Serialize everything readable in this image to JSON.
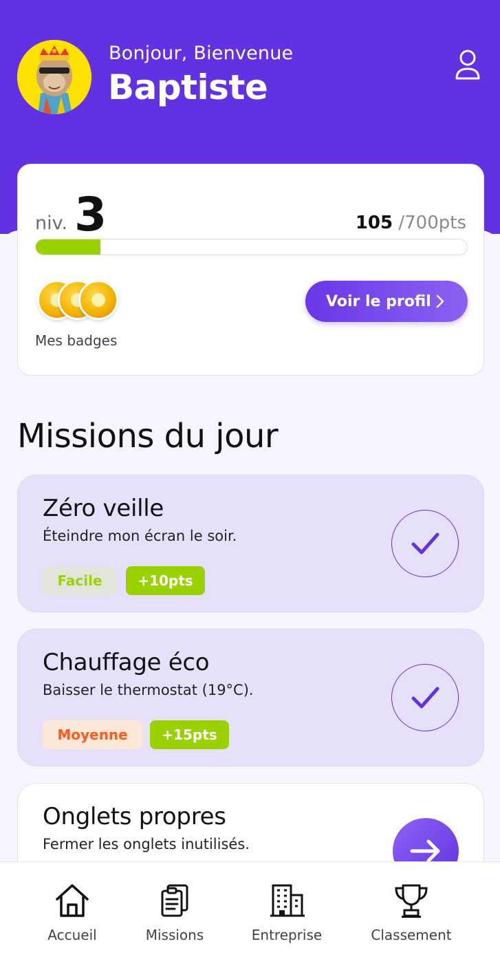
{
  "header": {
    "greeting": "Bonjour, Bienvenue",
    "username": "Baptiste",
    "avatar_icon": "ape-avatar-icon",
    "profile_icon": "user-icon"
  },
  "level_card": {
    "level_prefix": "niv.",
    "level_value": "3",
    "points_current": "105",
    "points_total": "/700pts",
    "progress_fraction": 0.15,
    "badges_label": "Mes badges",
    "badges_count": 3,
    "profile_button_label": "Voir le profil"
  },
  "missions": {
    "title": "Missions du jour",
    "items": [
      {
        "title": "Zéro veille",
        "description": "Éteindre mon écran le soir.",
        "difficulty": "Facile",
        "points": "+10pts",
        "status": "done"
      },
      {
        "title": "Chauffage éco",
        "description": "Baisser le thermostat (19°C).",
        "difficulty": "Moyenne",
        "points": "+15pts",
        "status": "done"
      },
      {
        "title": "Onglets propres",
        "description": "Fermer les onglets inutilisés.",
        "status": "todo"
      }
    ]
  },
  "nav": {
    "items": [
      {
        "label": "Accueil",
        "icon": "home-icon"
      },
      {
        "label": "Missions",
        "icon": "clipboard-icon"
      },
      {
        "label": "Entreprise",
        "icon": "building-icon"
      },
      {
        "label": "Classement",
        "icon": "trophy-icon"
      }
    ]
  },
  "colors": {
    "primary": "#6231e2",
    "accent_green": "#9ad100",
    "easy_bg": "#e2e6da",
    "easy_text": "#9ad100",
    "medium_bg": "#fde7d6",
    "medium_text": "#ff5a1f",
    "mission_done_bg": "#e6e0fa"
  }
}
